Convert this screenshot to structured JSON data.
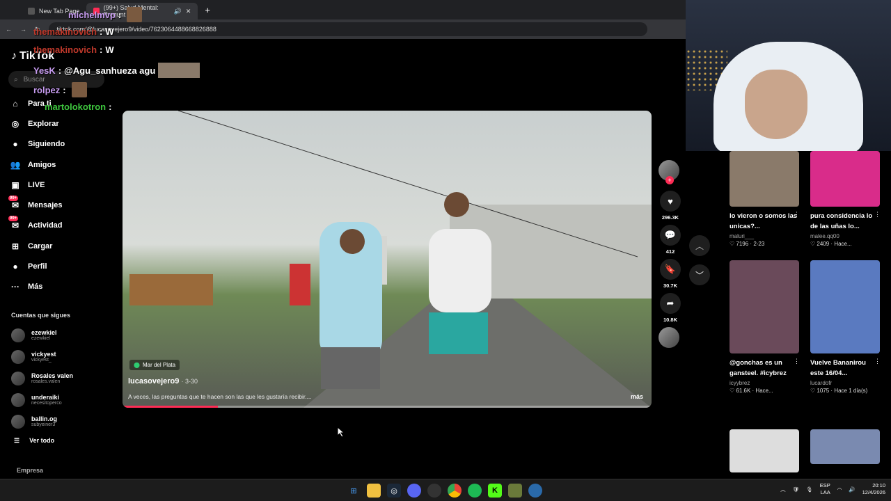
{
  "browser": {
    "tabs": [
      {
        "label": "New Tab Page",
        "active": false
      },
      {
        "label": "(99+) Salud Mental: Pregunt",
        "active": true
      }
    ],
    "new_tab_symbol": "+",
    "url": "tiktok.com/@lucasovejero9/video/7623064488668826888"
  },
  "chat": [
    {
      "user": "themakinovich",
      "message": "W",
      "color": "#c0392b"
    },
    {
      "user": "michelmvp",
      "message": "",
      "color": "#c79cf0"
    },
    {
      "user": "themakinovich",
      "message": "W",
      "color": "#c0392b"
    },
    {
      "user": "YesK",
      "message": "@Agu_sanhueza agu",
      "color": "#c79cf0"
    },
    {
      "user": "rolpez",
      "message": "",
      "color": "#c79cf0"
    },
    {
      "user": "martolokotron",
      "message": "",
      "color": "#3ec63e"
    }
  ],
  "sidebar": {
    "logo": "TikTok",
    "search_placeholder": "Buscar",
    "nav": [
      {
        "label": "Para ti",
        "icon": "home-icon",
        "badge": ""
      },
      {
        "label": "Explorar",
        "icon": "compass-icon",
        "badge": ""
      },
      {
        "label": "Siguiendo",
        "icon": "following-avatar-icon",
        "badge": ""
      },
      {
        "label": "Amigos",
        "icon": "friends-icon",
        "badge": ""
      },
      {
        "label": "LIVE",
        "icon": "live-icon",
        "badge": ""
      },
      {
        "label": "Mensajes",
        "icon": "message-icon",
        "badge": "99+"
      },
      {
        "label": "Actividad",
        "icon": "activity-icon",
        "badge": "99+"
      },
      {
        "label": "Cargar",
        "icon": "upload-icon",
        "badge": ""
      },
      {
        "label": "Perfil",
        "icon": "profile-icon",
        "badge": ""
      },
      {
        "label": "Más",
        "icon": "more-icon",
        "badge": ""
      }
    ],
    "following_title": "Cuentas que sigues",
    "following": [
      {
        "name": "ezewkiel",
        "user": "ezewkiel"
      },
      {
        "name": "vickyest",
        "user": "vickyest_"
      },
      {
        "name": "Rosales valen",
        "user": "rosales.valen"
      },
      {
        "name": "underaiki",
        "user": "necesitoperco"
      },
      {
        "name": "ballin.og",
        "user": "subyeiner3"
      }
    ],
    "see_all": "Ver todo",
    "company": "Empresa"
  },
  "video": {
    "location": "Mar del Plata",
    "author": "lucasovejero9",
    "date": "3-30",
    "caption": "A veces, las preguntas que te hacen son las que les gustaría recibir....",
    "more": "más",
    "progress": 0.18
  },
  "actions": {
    "likes": "296.3K",
    "comments": "412",
    "saves": "30.7K",
    "shares": "10.8K"
  },
  "feed": [
    {
      "title": "lo vieron o somos las unicas?...",
      "user": "maluri___",
      "count": "7196",
      "time": "2-23",
      "thumb": "#8a7a6a"
    },
    {
      "title": "pura consi­dencia lo de las uñas lo...",
      "user": "malee.qq00",
      "count": "2409",
      "time": "Hace...",
      "thumb": "#d92c8a"
    },
    {
      "title": "@gonchas es un gansteel. #icybrez",
      "user": "icyybrez",
      "count": "61.6K",
      "time": "Hace...",
      "thumb": "#6a4a5a"
    },
    {
      "title": "Vuelve Bananirou este 16/04...",
      "user": "lucardofr",
      "count": "1075",
      "time": "Hace 1 día(s)",
      "thumb": "#5a7ac0"
    },
    {
      "title": "",
      "user": "",
      "count": "",
      "time": "",
      "thumb": "#ddd"
    },
    {
      "title": "",
      "user": "",
      "count": "",
      "time": "",
      "thumb": "#7a8ab0"
    }
  ],
  "taskbar": {
    "lang": "ESP",
    "lang2": "LAA",
    "time": "20:10",
    "date": "12/4/2026"
  },
  "colors": {
    "accent": "#fe2c55",
    "background": "#000000"
  }
}
